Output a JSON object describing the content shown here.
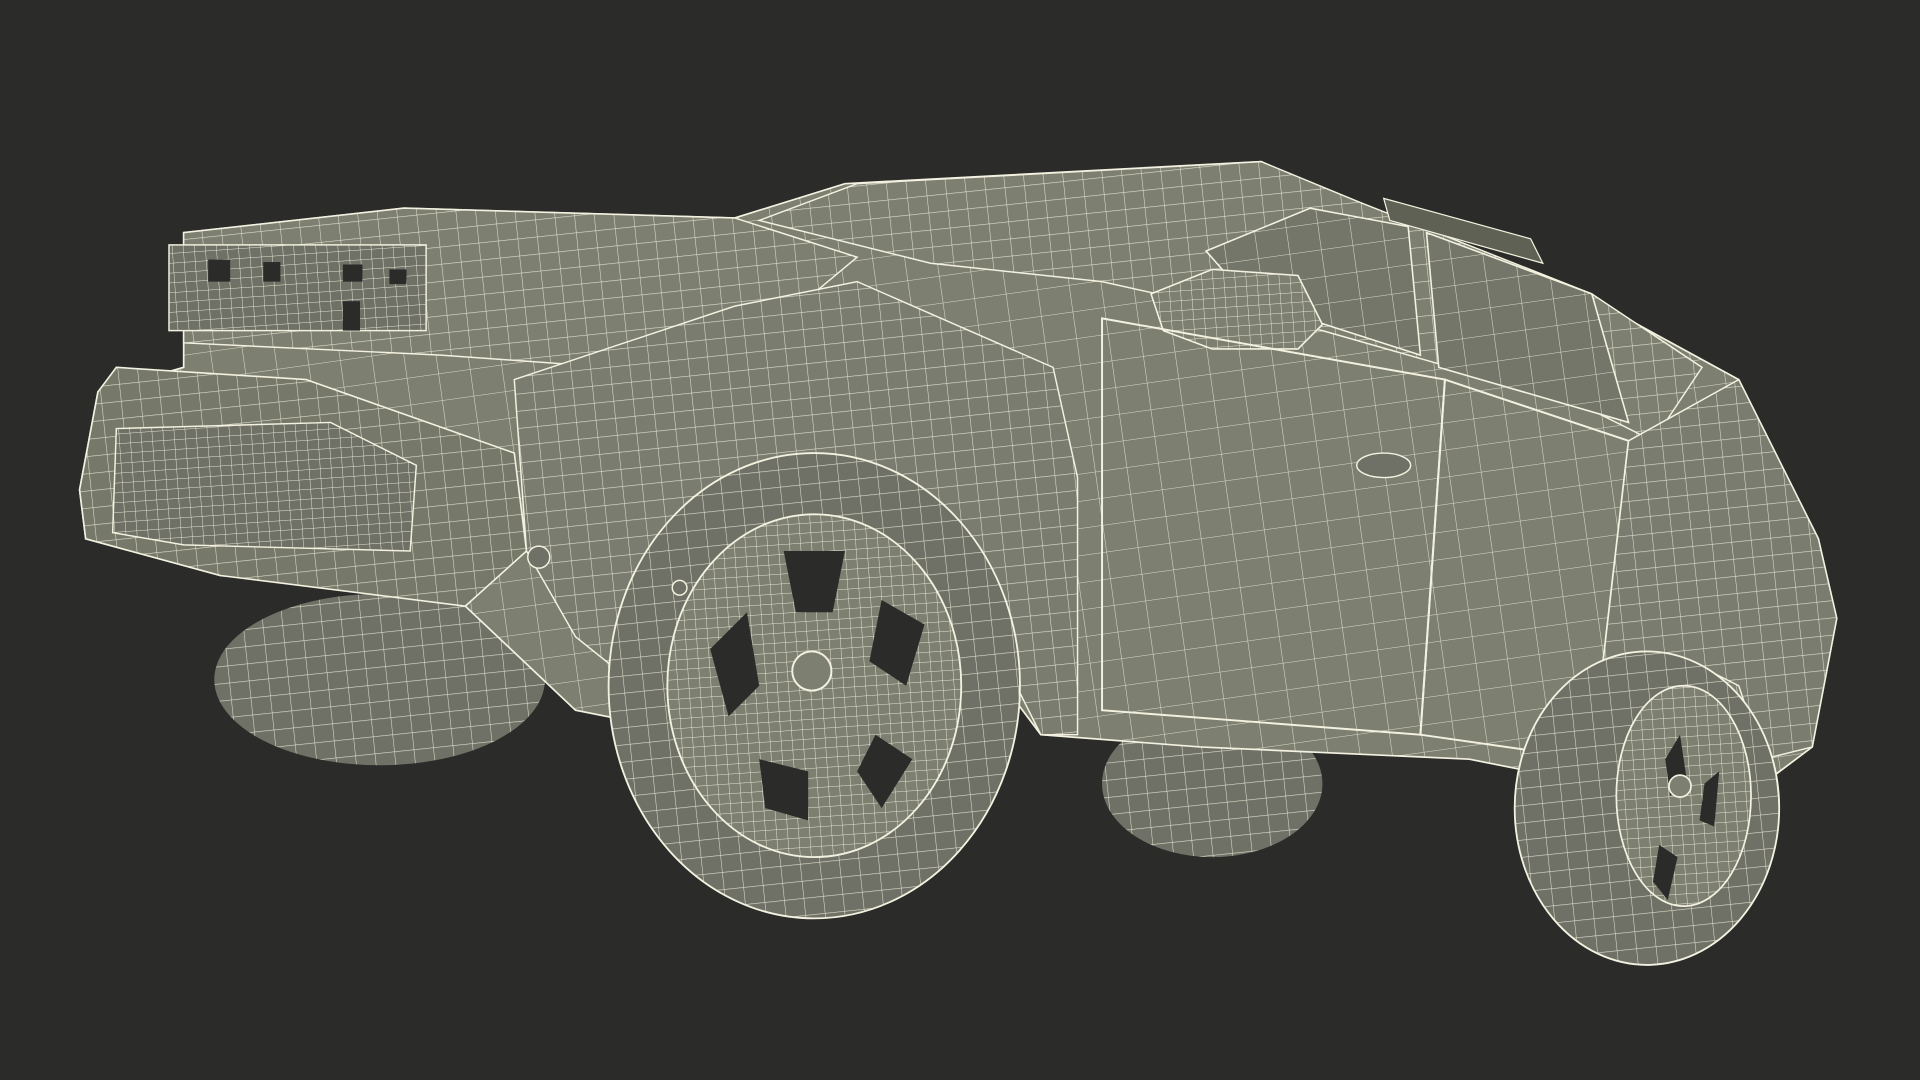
{
  "scene": {
    "subject": "suv-wireframe-render",
    "background_color": "#2b2b2a",
    "surface_color": "#7d7f71",
    "surface_shadow_color": "#5f6155",
    "wire_color": "#f3f1df",
    "tire_color": "#6f7166",
    "hole_color": "#2b2b2a"
  }
}
